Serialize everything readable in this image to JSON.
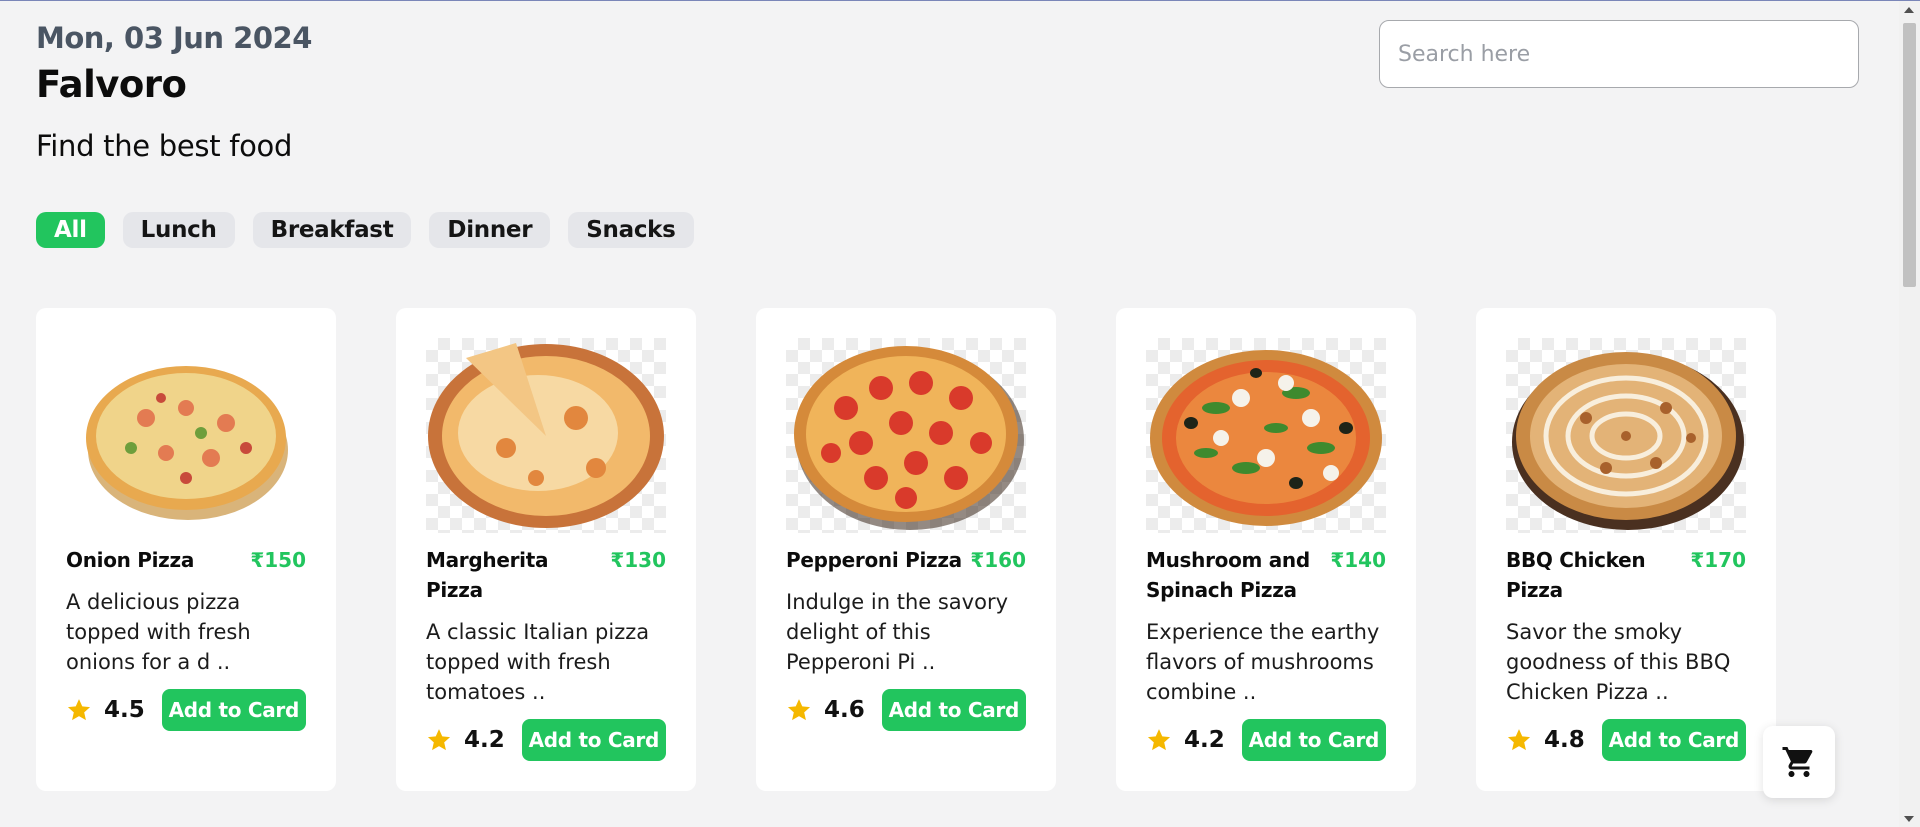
{
  "header": {
    "date": "Mon, 03 Jun 2024",
    "brand": "Falvoro",
    "tagline": "Find the best food"
  },
  "search": {
    "placeholder": "Search here",
    "value": ""
  },
  "filters": {
    "items": [
      {
        "label": "All",
        "active": true
      },
      {
        "label": "Lunch",
        "active": false
      },
      {
        "label": "Breakfast",
        "active": false
      },
      {
        "label": "Dinner",
        "active": false
      },
      {
        "label": "Snacks",
        "active": false
      }
    ]
  },
  "products": {
    "items": [
      {
        "name": "Onion Pizza",
        "price": "₹150",
        "description": "A delicious pizza topped with fresh onions for a d ..",
        "rating": "4.5",
        "button": "Add to Card",
        "image": "onion-pizza-image"
      },
      {
        "name": "Margherita Pizza",
        "price": "₹130",
        "description": "A classic Italian pizza topped with fresh tomatoes ..",
        "rating": "4.2",
        "button": "Add to Card",
        "image": "margherita-pizza-image"
      },
      {
        "name": "Pepperoni Pizza",
        "price": "₹160",
        "description": "Indulge in the savory delight of this Pepperoni Pi ..",
        "rating": "4.6",
        "button": "Add to Card",
        "image": "pepperoni-pizza-image"
      },
      {
        "name": "Mushroom and Spinach Pizza",
        "price": "₹140",
        "description": "Experience the earthy flavors of mushrooms combine ..",
        "rating": "4.2",
        "button": "Add to Card",
        "image": "mushroom-spinach-pizza-image"
      },
      {
        "name": "BBQ Chicken Pizza",
        "price": "₹170",
        "description": "Savor the smoky goodness of this BBQ Chicken Pizza ..",
        "rating": "4.8",
        "button": "Add to Card",
        "image": "bbq-chicken-pizza-image"
      }
    ]
  },
  "cart": {
    "icon": "cart-icon"
  },
  "colors": {
    "accent": "#22c55e",
    "star": "#f5b800",
    "background": "#f3f3f4"
  }
}
